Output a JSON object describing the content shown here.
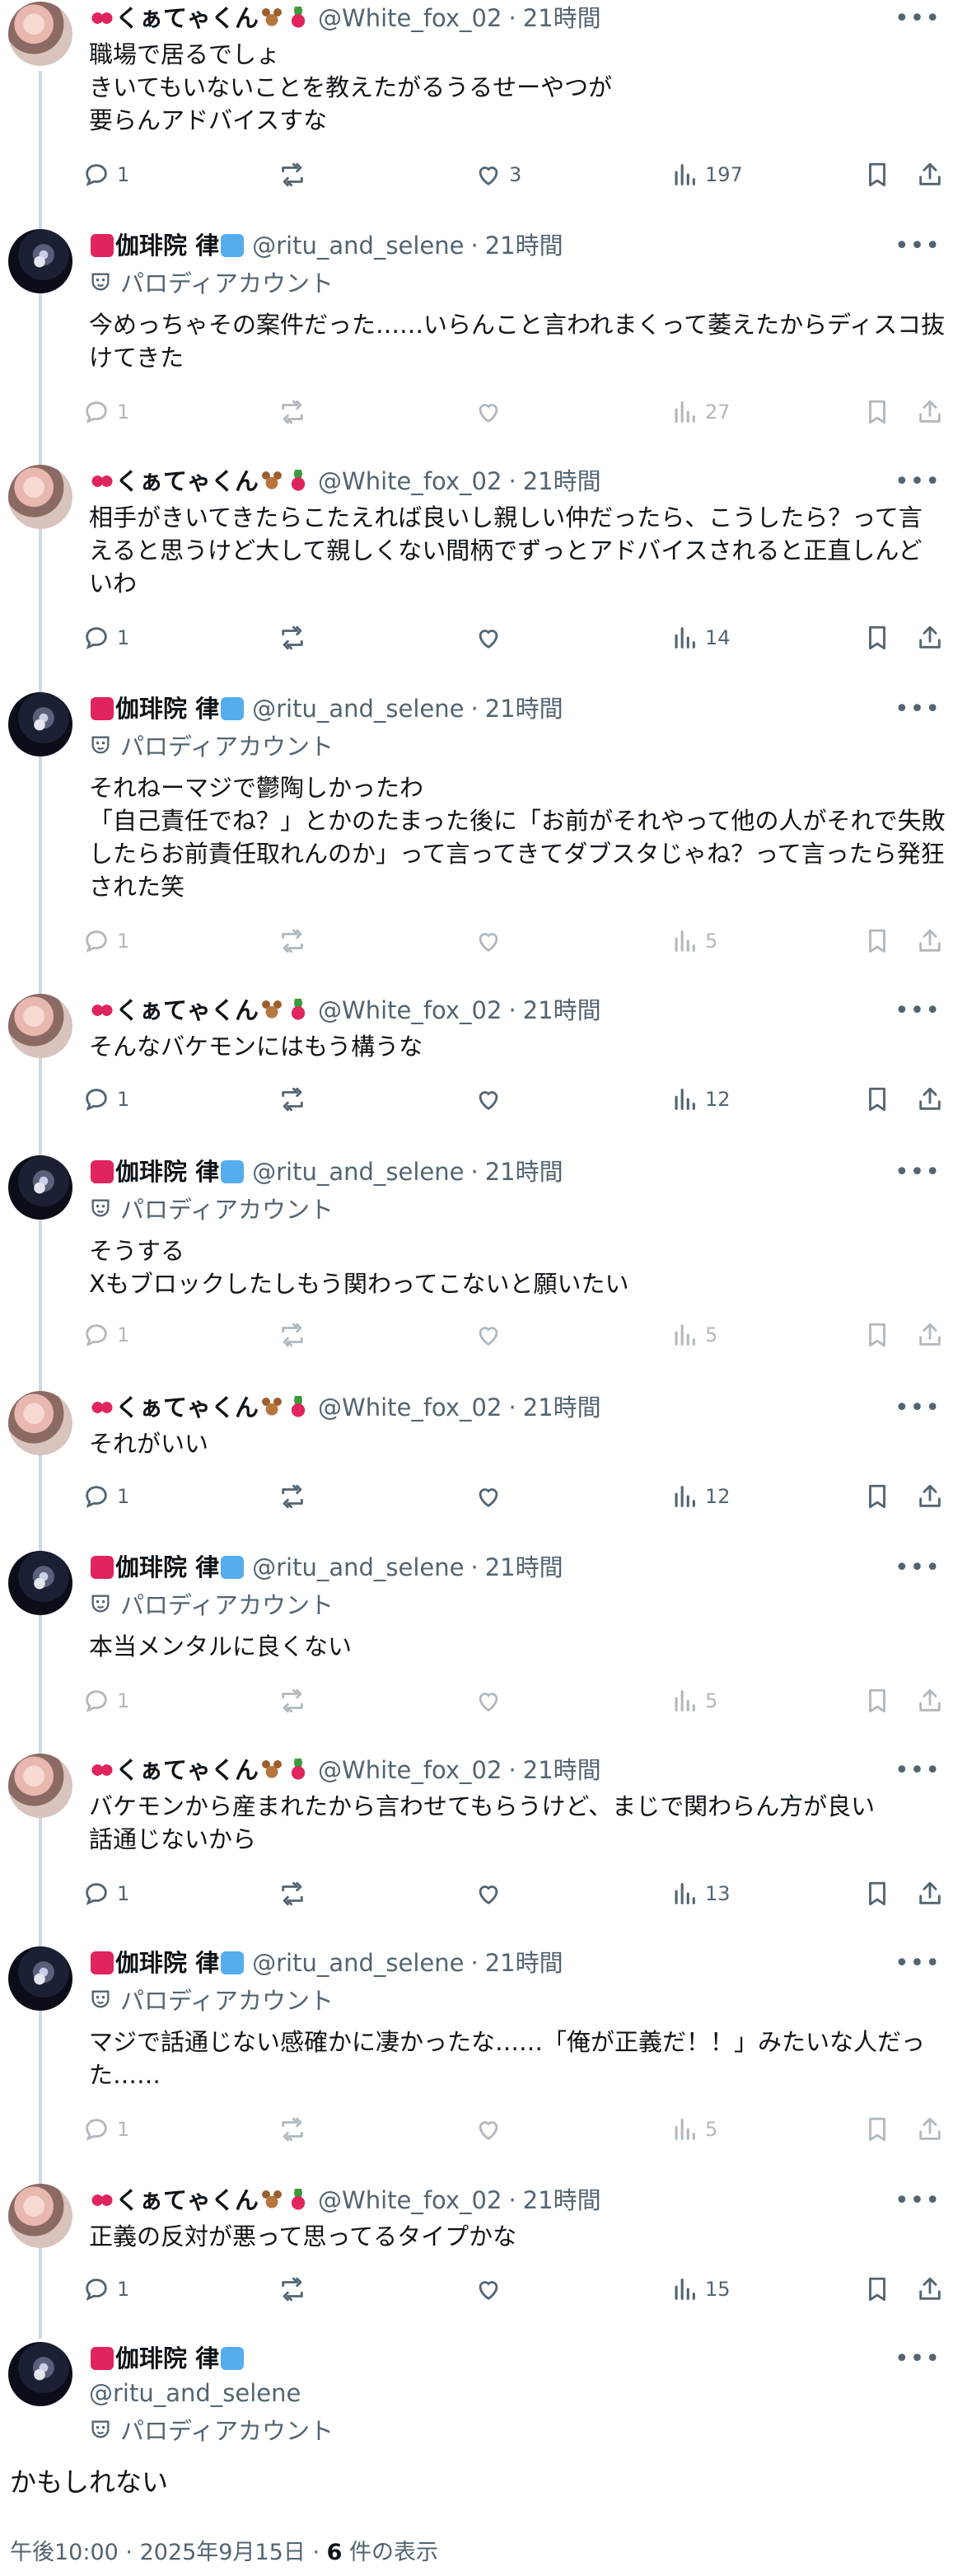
{
  "users": {
    "fox": {
      "name": "くぁてゃくん",
      "handle": "@White_fox_02"
    },
    "ritu": {
      "name": "伽琲院 律",
      "handle": "@ritu_and_selene",
      "badge": "パロディアカウント"
    }
  },
  "separator": "·",
  "posts": [
    {
      "user": "fox",
      "time": "21時間",
      "text": "職場で居るでしょ\nきいてもいないことを教えたがるうるせーやつが\n要らんアドバイスすな",
      "replies": "1",
      "likes": "3",
      "views": "197"
    },
    {
      "user": "ritu",
      "time": "21時間",
      "text": "今めっちゃその案件だった……いらんこと言われまくって萎えたからディスコ抜けてきた",
      "replies": "1",
      "likes": "",
      "views": "27"
    },
    {
      "user": "fox",
      "time": "21時間",
      "text": "相手がきいてきたらこたえれば良いし親しい仲だったら、こうしたら？って言えると思うけど大して親しくない間柄でずっとアドバイスされると正直しんどいわ",
      "replies": "1",
      "likes": "",
      "views": "14"
    },
    {
      "user": "ritu",
      "time": "21時間",
      "text": "それねーマジで鬱陶しかったわ\n「自己責任でね？」とかのたまった後に「お前がそれやって他の人がそれで失敗したらお前責任取れんのか」って言ってきてダブスタじゃね？って言ったら発狂された笑",
      "replies": "1",
      "likes": "",
      "views": "5"
    },
    {
      "user": "fox",
      "time": "21時間",
      "text": "そんなバケモンにはもう構うな",
      "replies": "1",
      "likes": "",
      "views": "12"
    },
    {
      "user": "ritu",
      "time": "21時間",
      "text": "そうする\nXもブロックしたしもう関わってこないと願いたい",
      "replies": "1",
      "likes": "",
      "views": "5"
    },
    {
      "user": "fox",
      "time": "21時間",
      "text": "それがいい",
      "replies": "1",
      "likes": "",
      "views": "12"
    },
    {
      "user": "ritu",
      "time": "21時間",
      "text": "本当メンタルに良くない",
      "replies": "1",
      "likes": "",
      "views": "5"
    },
    {
      "user": "fox",
      "time": "21時間",
      "text": "バケモンから産まれたから言わせてもらうけど、まじで関わらん方が良い\n話通じないから",
      "replies": "1",
      "likes": "",
      "views": "13"
    },
    {
      "user": "ritu",
      "time": "21時間",
      "text": "マジで話通じない感確かに凄かったな……「俺が正義だ！！」みたいな人だった……",
      "replies": "1",
      "likes": "",
      "views": "5"
    },
    {
      "user": "fox",
      "time": "21時間",
      "text": "正義の反対が悪って思ってるタイプかな",
      "replies": "1",
      "likes": "",
      "views": "15"
    }
  ],
  "main_post": {
    "text": "かもしれない",
    "time": "午後10:00",
    "date": "2025年9月15日",
    "views_count": "6",
    "views_label": "件の表示"
  }
}
